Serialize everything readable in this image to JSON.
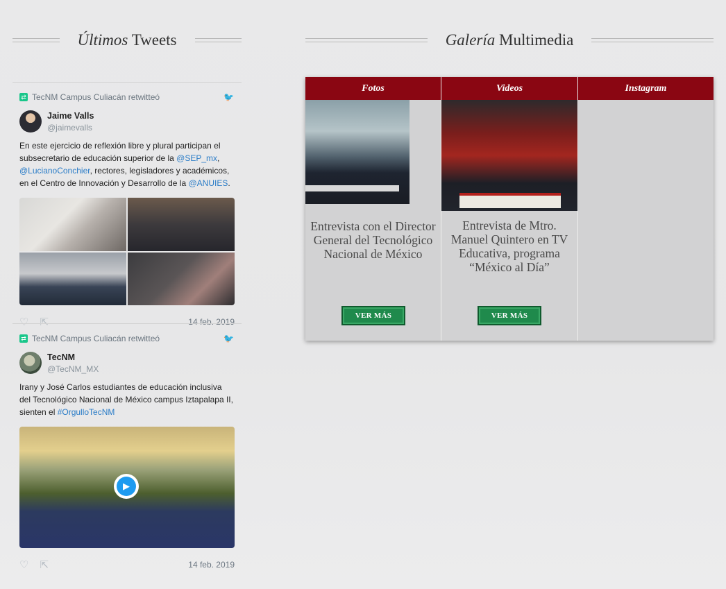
{
  "tweets_header": {
    "title_italic": "Últimos",
    "title_rest": "Tweets"
  },
  "gallery_header": {
    "title_italic": "Galería",
    "title_rest": "Multimedia"
  },
  "tweets": [
    {
      "retweet_label": "TecNM Campus Culiacán retwitteó",
      "author_name": "Jaime Valls",
      "author_handle": "@jaimevalls",
      "text_parts": {
        "p1": "En este ejercicio de reflexión libre y plural participan el subsecretario de educación superior de la ",
        "m1": "@SEP_mx",
        "p2": ", ",
        "m2": "@LucianoConchier",
        "p3": ", rectores, legisladores y académicos, en el Centro de Innovación y Desarrollo de la ",
        "m3": "@ANUIES",
        "p4": "."
      },
      "date": "14 feb. 2019"
    },
    {
      "retweet_label": "TecNM Campus Culiacán retwitteó",
      "author_name": "TecNM",
      "author_handle": "@TecNM_MX",
      "text_parts": {
        "p1": "Irany y José Carlos estudiantes de educación inclusiva del Tecnológico Nacional de México campus Iztapalapa II, sienten el ",
        "m1": "#OrgulloTecNM"
      },
      "date": "14 feb. 2019"
    }
  ],
  "gallery": {
    "tabs": [
      "Fotos",
      "Videos",
      "Instagram"
    ],
    "items": [
      {
        "caption": "Entrevista con el Director General del Tecnológico Nacional de México",
        "button": "VER MÁS"
      },
      {
        "caption": "Entrevista de Mtro. Manuel Quintero en TV Educativa, programa “México al Día”",
        "button": "VER MÁS"
      }
    ]
  },
  "icons": {
    "retweet": "retweet-icon",
    "bird": "twitter-bird-icon",
    "like": "heart-icon",
    "share": "share-icon",
    "play": "play-icon"
  },
  "colors": {
    "tab_red": "#8a0612",
    "button_green": "#1f8a4c",
    "mention_blue": "#2a7cc7",
    "retweet_green": "#19c68a"
  }
}
